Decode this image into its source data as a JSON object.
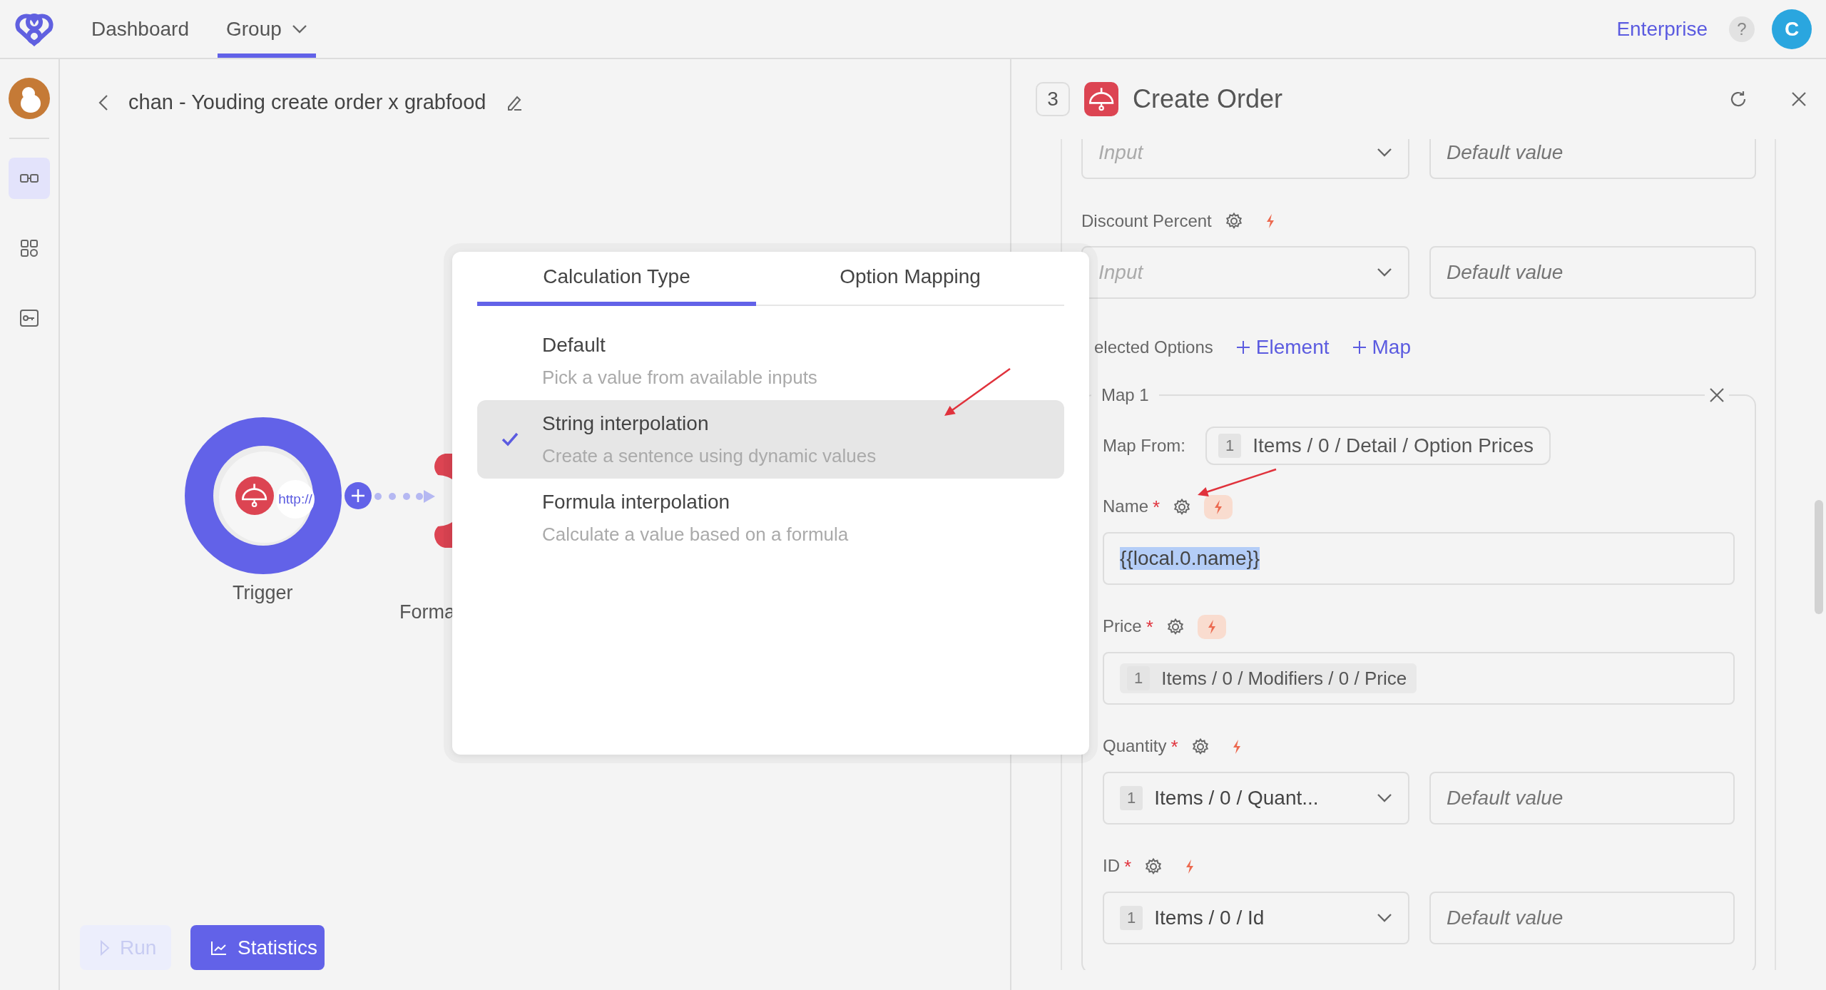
{
  "nav": {
    "items": [
      {
        "label": "Dashboard",
        "selected": false,
        "has_menu": false
      },
      {
        "label": "Group",
        "selected": true,
        "has_menu": true
      }
    ]
  },
  "account": {
    "plan": "Enterprise",
    "help": "?",
    "avatar": "C"
  },
  "sidebar": {
    "items": [
      {
        "kind": "links",
        "selected": true
      },
      {
        "kind": "apps",
        "selected": false
      },
      {
        "kind": "key",
        "selected": false
      }
    ]
  },
  "workflow": {
    "title": "chan - Youding create order x grabfood"
  },
  "canvas": {
    "nodes": [
      {
        "kind": "trigger",
        "label": "Trigger",
        "badge": "http://"
      },
      {
        "kind": "action",
        "label": "Forma"
      }
    ]
  },
  "toolbar": {
    "buttons": [
      {
        "kind": "run",
        "label": "Run",
        "disabled": true
      },
      {
        "kind": "stats",
        "label": "Statistics",
        "disabled": false
      }
    ]
  },
  "popup": {
    "tabs": [
      {
        "label": "Calculation Type",
        "selected": true
      },
      {
        "label": "Option Mapping",
        "selected": false
      }
    ],
    "options": [
      {
        "title": "Default",
        "description": "Pick a value from available inputs",
        "selected": false
      },
      {
        "title": "String interpolation",
        "description": "Create a sentence using dynamic values",
        "selected": true
      },
      {
        "title": "Formula interpolation",
        "description": "Calculate a value based on a formula",
        "selected": false
      }
    ]
  },
  "panel": {
    "step": "3",
    "title": "Create Order",
    "fields": [
      {
        "kind": "select",
        "placeholder": "Input",
        "default_placeholder": "Default value"
      },
      {
        "label": "Discount Percent",
        "bolt_active": false,
        "kind": "select",
        "placeholder": "Input",
        "default_placeholder": "Default value"
      }
    ],
    "options": {
      "label": "elected Options",
      "actions": [
        "Element",
        "Map"
      ]
    },
    "map": {
      "legend": "Map 1",
      "from_label": "Map From:",
      "from": {
        "index": "1",
        "path": "Items / 0 / Detail / Option Prices"
      },
      "fields": [
        {
          "label": "Name",
          "required_mark": "*",
          "bolt_active": true,
          "kind": "text",
          "value": "{{local.0.name}}",
          "value_selected": true
        },
        {
          "label": "Price",
          "required_mark": "*",
          "bolt_active": true,
          "kind": "chip",
          "chip": {
            "index": "1",
            "path": "Items / 0 / Modifiers / 0 / Price"
          }
        },
        {
          "label": "Quantity",
          "required_mark": "*",
          "bolt_active": false,
          "kind": "select",
          "chip": {
            "index": "1",
            "path": "Items / 0 / Quant..."
          },
          "default_placeholder": "Default value"
        },
        {
          "label": "ID",
          "required_mark": "*",
          "bolt_active": false,
          "kind": "select",
          "chip": {
            "index": "1",
            "path": "Items / 0 / Id"
          },
          "default_placeholder": "Default value"
        }
      ]
    }
  }
}
